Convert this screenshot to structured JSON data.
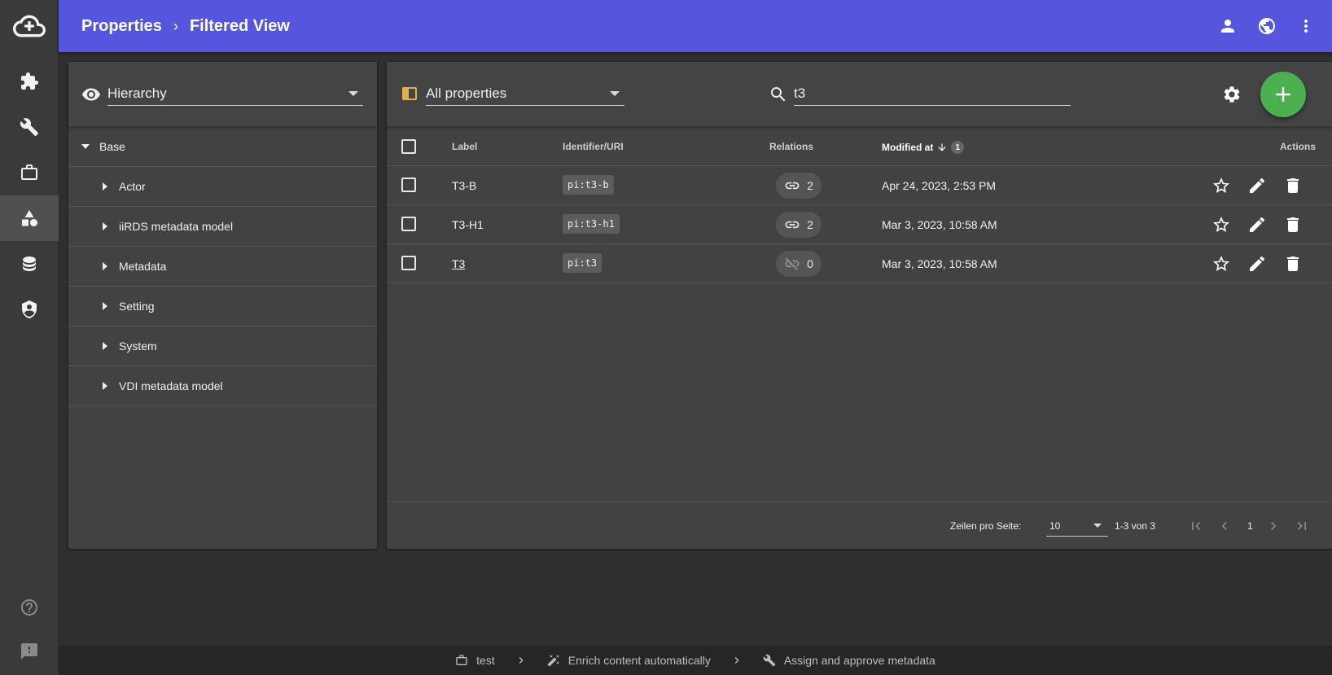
{
  "breadcrumb": {
    "root": "Properties",
    "current": "Filtered View"
  },
  "left_panel": {
    "view_select": "Hierarchy",
    "tree": {
      "root": "Base",
      "children": [
        "Actor",
        "iiRDS metadata model",
        "Metadata",
        "Setting",
        "System",
        "VDI metadata model"
      ]
    }
  },
  "right_panel": {
    "filter_select": "All properties",
    "search_value": "t3",
    "columns": {
      "label": "Label",
      "identifier": "Identifier/URI",
      "relations": "Relations",
      "modified": "Modified at",
      "sort_index": "1",
      "actions": "Actions"
    },
    "rows": [
      {
        "label": "T3-B",
        "identifier": "pi:t3-b",
        "relations": "2",
        "modified": "Apr 24, 2023, 2:53 PM"
      },
      {
        "label": "T3-H1",
        "identifier": "pi:t3-h1",
        "relations": "2",
        "modified": "Mar 3, 2023, 10:58 AM"
      },
      {
        "label": "T3",
        "identifier": "pi:t3",
        "relations": "0",
        "modified": "Mar 3, 2023, 10:58 AM"
      }
    ],
    "pagination": {
      "rows_per_page_label": "Zeilen pro Seite:",
      "rows_per_page": "10",
      "range": "1-3 von 3",
      "page": "1"
    }
  },
  "statusbar": {
    "item1": "test",
    "item2": "Enrich content automatically",
    "item3": "Assign and approve metadata"
  },
  "colors": {
    "topbar": "#5555dd",
    "add_button": "#4caf50",
    "background": "#2f2f2f",
    "panel": "#424242"
  },
  "icons": [
    "cloud-add-icon",
    "puzzle-icon",
    "wrench-icon",
    "briefcase-icon",
    "shapes-icon",
    "database-icon",
    "shield-account-icon",
    "help-icon",
    "feedback-icon",
    "account-icon",
    "globe-icon",
    "more-vert-icon",
    "eye-icon",
    "search-icon",
    "settings-icon",
    "add-icon",
    "link-icon",
    "link-off-icon",
    "star-outline-icon",
    "pencil-icon",
    "delete-icon"
  ]
}
